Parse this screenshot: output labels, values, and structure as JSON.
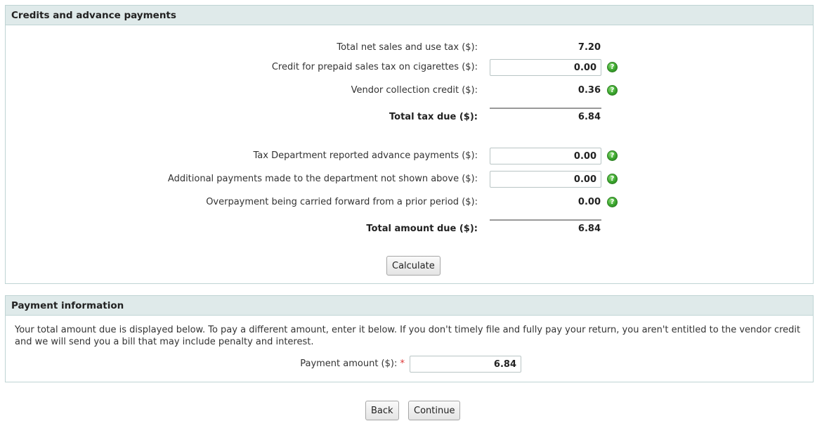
{
  "credits": {
    "title": "Credits and advance payments",
    "total_net_sales_tax": {
      "label": "Total net sales and use tax ($):",
      "value": "7.20"
    },
    "cigarette_credit": {
      "label": "Credit for prepaid sales tax on cigarettes ($):",
      "value": "0.00"
    },
    "vendor_credit": {
      "label": "Vendor collection credit ($):",
      "value": "0.36"
    },
    "total_tax_due": {
      "label": "Total tax due ($):",
      "value": "6.84"
    },
    "advance_payments": {
      "label": "Tax Department reported advance payments ($):",
      "value": "0.00"
    },
    "additional_payments": {
      "label": "Additional payments made to the department not shown above ($):",
      "value": "0.00"
    },
    "overpayment": {
      "label": "Overpayment being carried forward from a prior period ($):",
      "value": "0.00"
    },
    "total_amount_due": {
      "label": "Total amount due ($):",
      "value": "6.84"
    },
    "calculate_label": "Calculate"
  },
  "payment": {
    "title": "Payment information",
    "info_text": "Your total amount due is displayed below. To pay a different amount, enter it below. If you don't timely file and fully pay your return, you aren't entitled to the vendor credit and we will send you a bill that may include penalty and interest.",
    "amount_label": "Payment amount ($):",
    "required_mark": "*",
    "amount_value": "6.84"
  },
  "footer": {
    "back_label": "Back",
    "continue_label": "Continue"
  },
  "icons": {
    "help": "help-icon",
    "help_glyph": "?"
  }
}
